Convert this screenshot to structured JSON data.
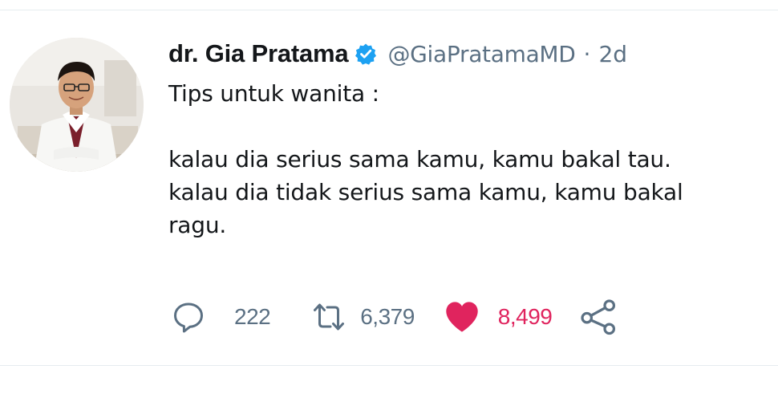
{
  "tweet": {
    "display_name": "dr. Gia Pratama",
    "handle": "@GiaPratamaMD",
    "separator": "·",
    "time": "2d",
    "lines": [
      "Tips untuk wanita :",
      "",
      "kalau dia serius sama kamu, kamu bakal tau.",
      "kalau dia tidak serius sama kamu, kamu bakal",
      "ragu."
    ]
  },
  "actions": {
    "reply": {
      "icon": "reply-icon",
      "count": "222"
    },
    "retweet": {
      "icon": "retweet-icon",
      "count": "6,379"
    },
    "like": {
      "icon": "heart-icon",
      "count": "8,499"
    },
    "share": {
      "icon": "share-icon"
    }
  },
  "colors": {
    "text": "#14171a",
    "secondary": "#5b7083",
    "verified": "#1da1f2",
    "like": "#e0245e",
    "divider": "#e6ecf0"
  }
}
